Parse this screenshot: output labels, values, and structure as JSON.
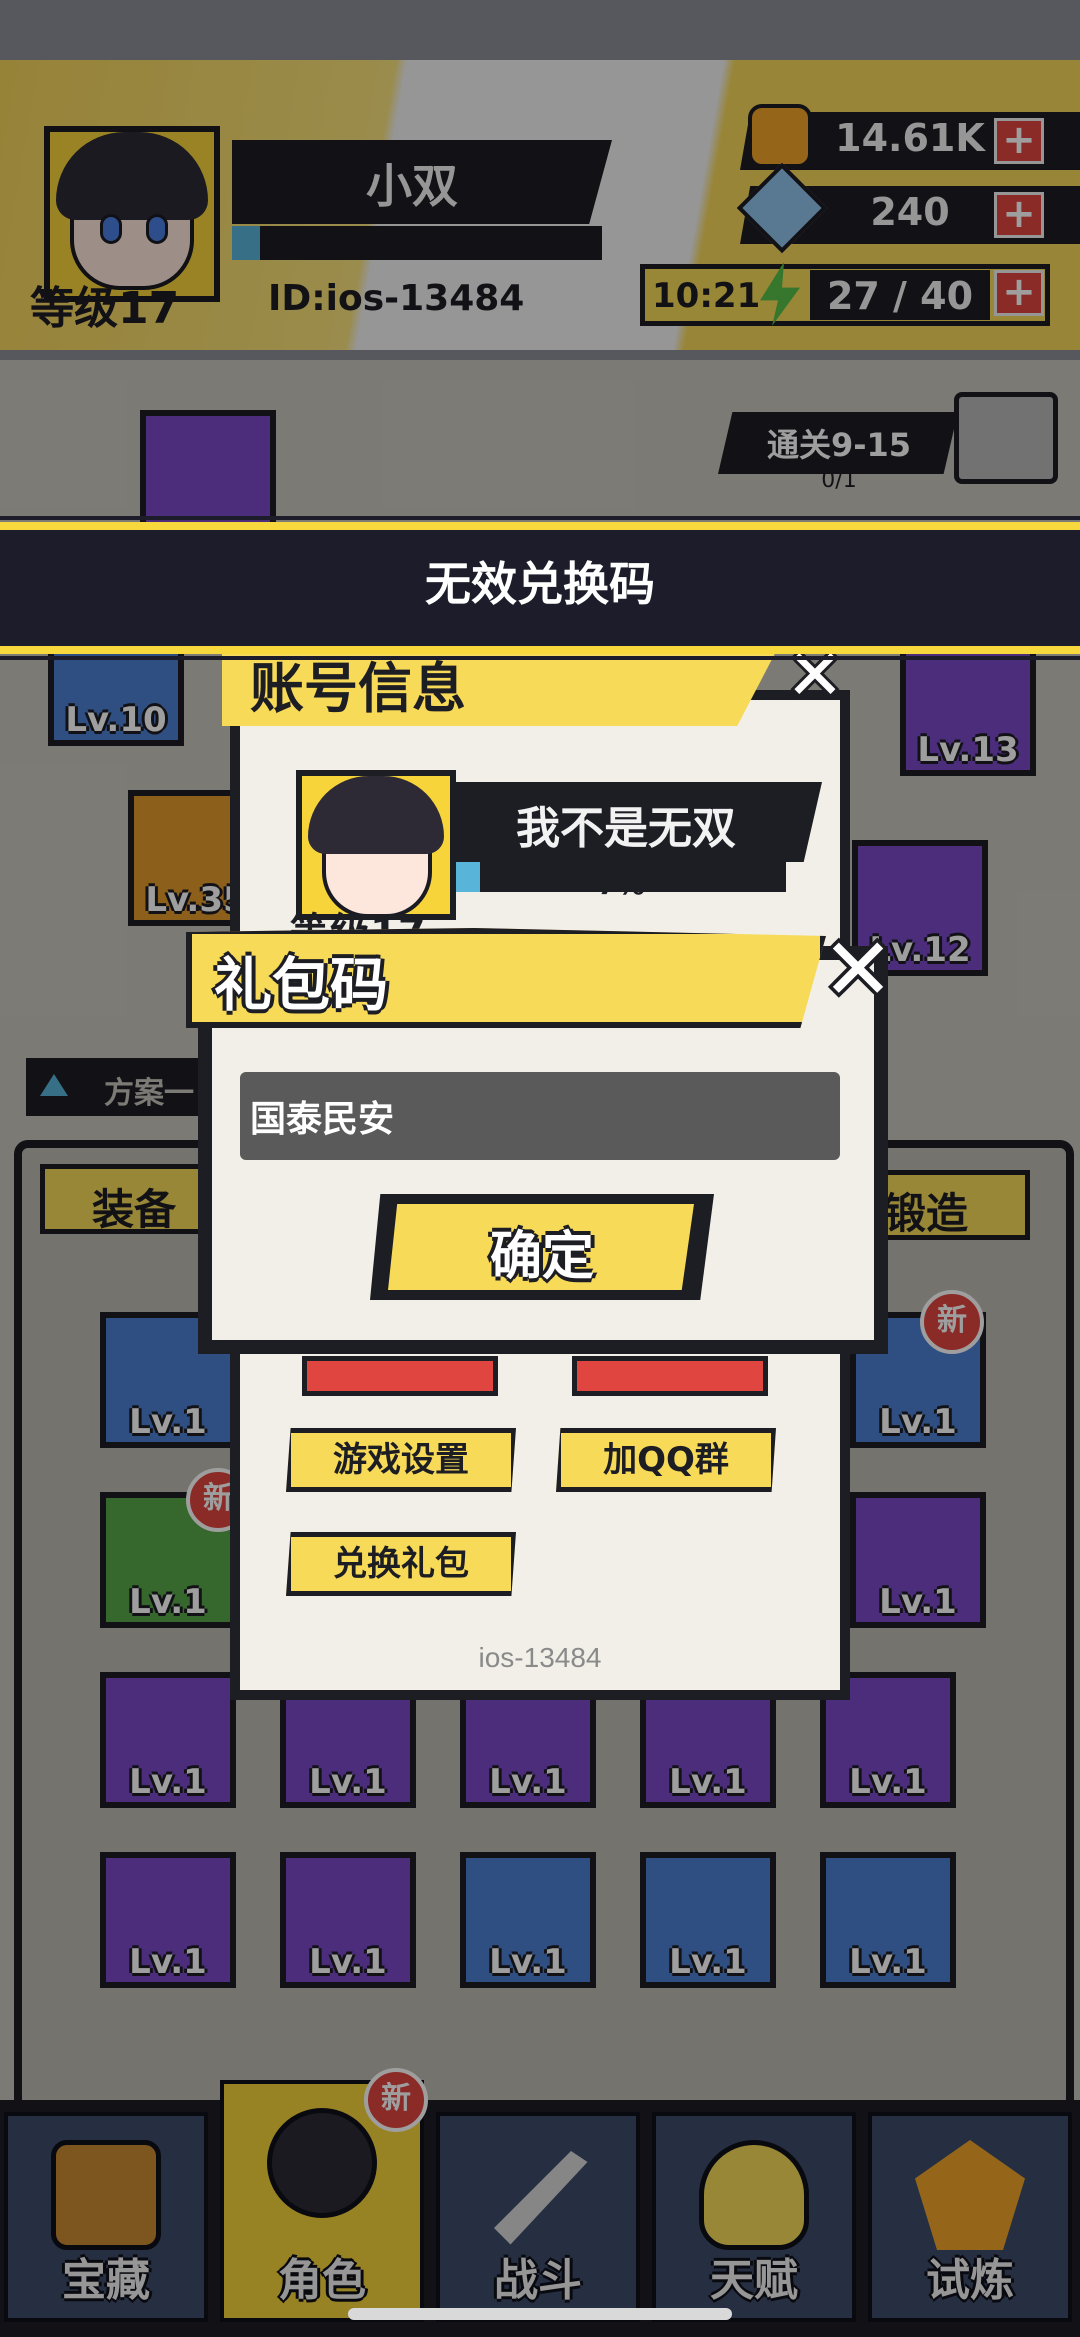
{
  "player": {
    "name": "小双",
    "xp_percent": "7%",
    "level": "等级17",
    "id": "ID:ios-13484"
  },
  "resources": {
    "coins": "14.61K",
    "gems": "240",
    "energy_timer": "10:21",
    "energy": "27 / 40",
    "plus": "+"
  },
  "quest": {
    "label": "通关9-15",
    "progress": "0/1"
  },
  "toast": {
    "message": "无效兑换码"
  },
  "account_panel": {
    "title": "账号信息",
    "name": "我不是无双",
    "xp_percent": "7%",
    "level": "等级17",
    "buttons": {
      "game_settings": "游戏设置",
      "join_qq": "加QQ群",
      "redeem_gift": "兑换礼包"
    },
    "footer_id": "ios-13484",
    "close": "✕"
  },
  "gift_dialog": {
    "title": "礼包码",
    "input_value": "国泰民安",
    "confirm": "确定",
    "close": "✕"
  },
  "equipment": {
    "tab_equip": "装备",
    "tab_forge": "锻造",
    "plan": "方案一",
    "badge_new": "新",
    "slot_levels": [
      "Lv.10",
      "Lv.35",
      "Lv.13",
      "Lv.12",
      "Lv.1",
      "Lv.1",
      "Lv.1",
      "Lv.1",
      "Lv.1",
      "Lv.1",
      "Lv.1",
      "Lv.1",
      "Lv.1",
      "Lv.1",
      "Lv.1",
      "Lv.1",
      "Lv.1",
      "Lv.1",
      "Lv.1"
    ]
  },
  "nav": {
    "tabs": [
      {
        "label": "宝藏"
      },
      {
        "label": "角色"
      },
      {
        "label": "战斗"
      },
      {
        "label": "天赋"
      },
      {
        "label": "试炼"
      }
    ],
    "badge_new": "新"
  },
  "colors": {
    "accent_yellow": "#f6da58",
    "dark": "#1d1d24",
    "alert_red": "#e0463f",
    "xp_blue": "#58b4d8"
  }
}
